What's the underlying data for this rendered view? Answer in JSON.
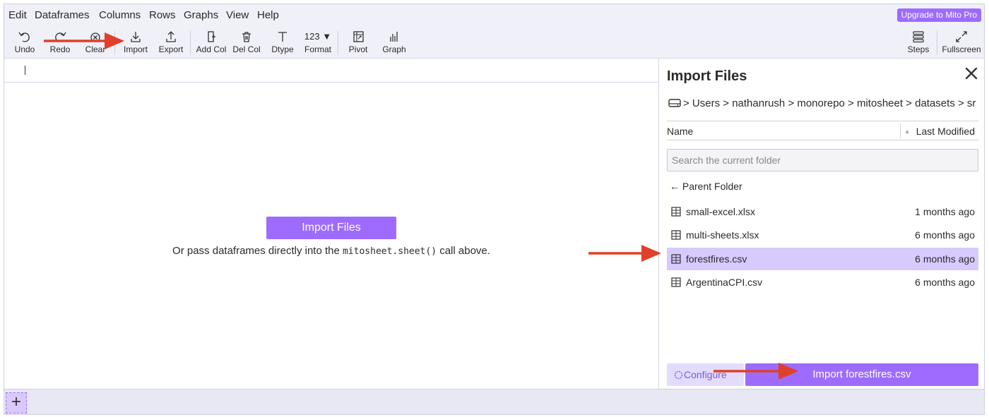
{
  "menu": {
    "items": [
      "Edit",
      "Dataframes",
      "Columns",
      "Rows",
      "Graphs",
      "View",
      "Help"
    ],
    "upgrade_label": "Upgrade to Mito Pro"
  },
  "toolbar": {
    "undo": "Undo",
    "redo": "Redo",
    "clear": "Clear",
    "import": "Import",
    "export": "Export",
    "add_col": "Add Col",
    "del_col": "Del Col",
    "dtype": "Dtype",
    "format": "Format",
    "format_icon_text": "123 ▼",
    "pivot": "Pivot",
    "graph": "Graph",
    "steps": "Steps",
    "fullscreen": "Fullscreen"
  },
  "main": {
    "import_button": "Import Files",
    "hint_prefix": "Or pass dataframes directly into the ",
    "hint_code": "mitosheet.sheet()",
    "hint_suffix": " call above."
  },
  "taskpane": {
    "title": "Import Files",
    "breadcrumb": "> Users > nathanrush > monorepo > mitosheet > datasets > sr",
    "col_name": "Name",
    "col_modified": "Last Modified",
    "search_placeholder": "Search the current folder",
    "parent_folder": "← Parent Folder",
    "files": [
      {
        "name": "small-excel.xlsx",
        "modified": "1 months ago"
      },
      {
        "name": "multi-sheets.xlsx",
        "modified": "6 months ago"
      },
      {
        "name": "forestfires.csv",
        "modified": "6 months ago"
      },
      {
        "name": "ArgentinaCPI.csv",
        "modified": "6 months ago"
      }
    ],
    "selected_file": "forestfires.csv",
    "configure_label": "Configure",
    "import_button": "Import forestfires.csv"
  },
  "sheetbar": {
    "add_label": "+"
  },
  "colors": {
    "accent": "#9d6cff",
    "selected_row": "#d8c9ff",
    "annotation_arrow": "#e0402a",
    "toolbar_bg": "#f0f0f8"
  }
}
